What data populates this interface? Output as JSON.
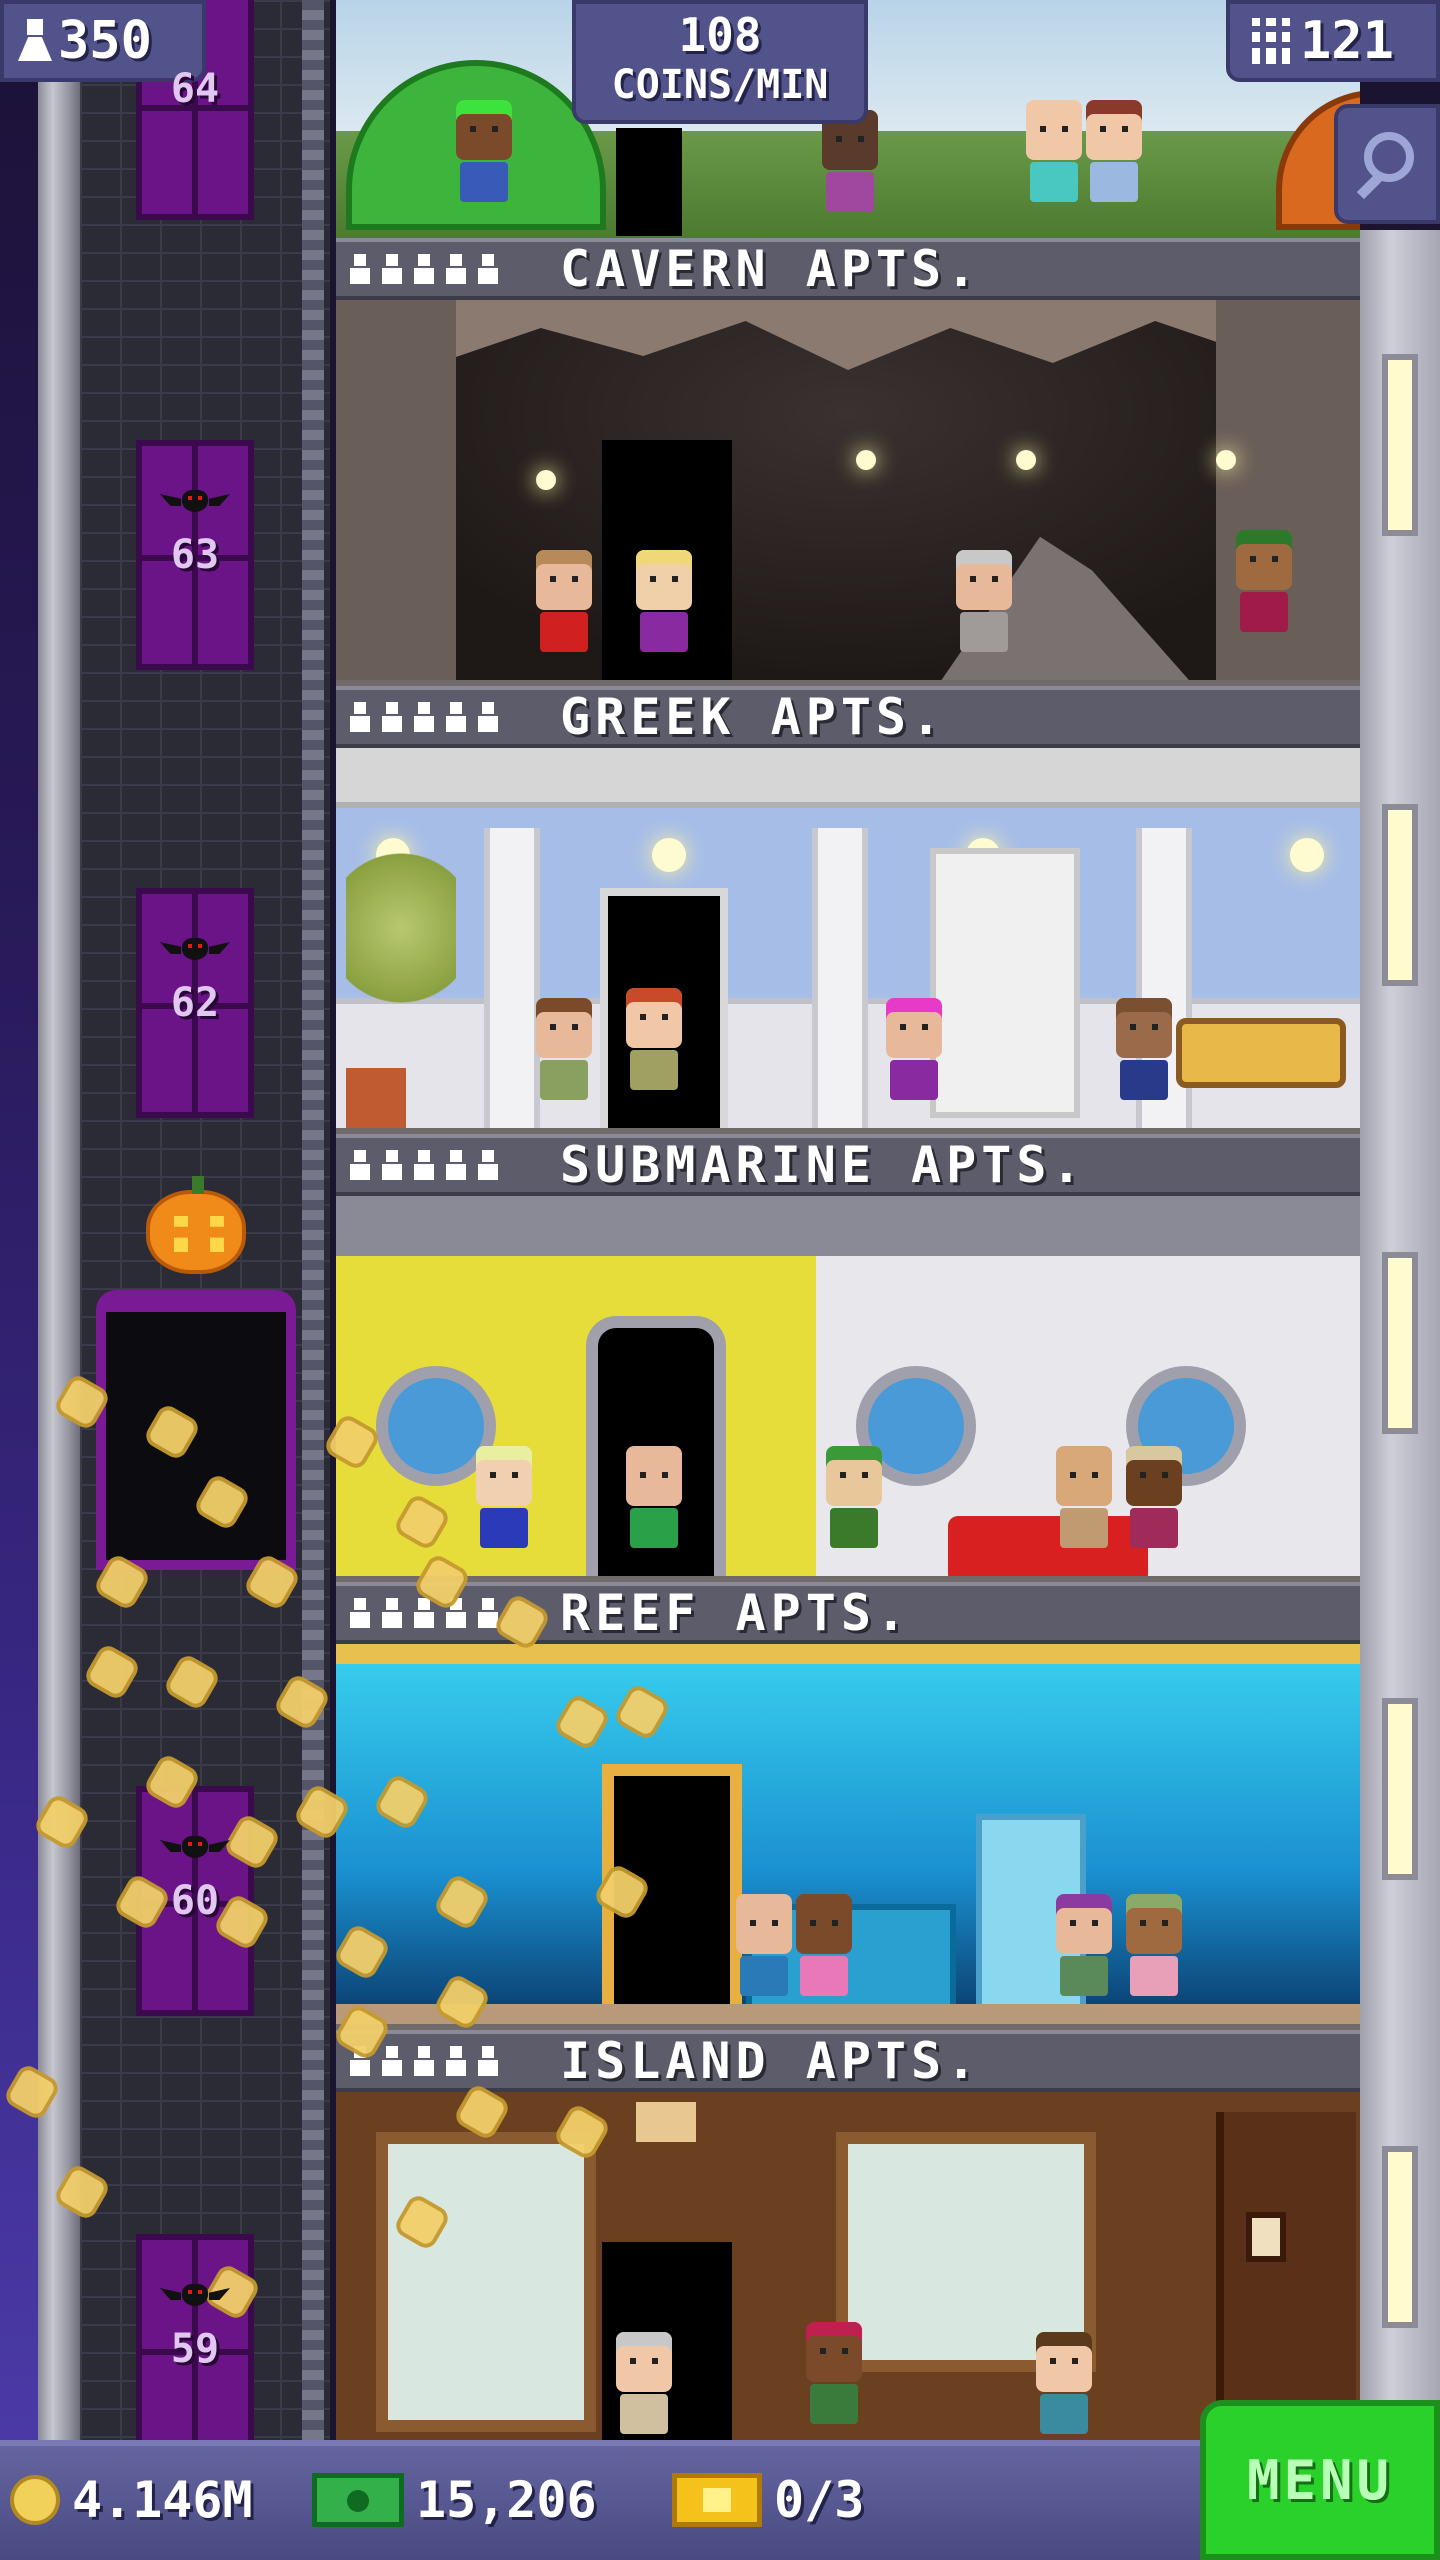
{
  "hud": {
    "population": "350",
    "coins_per_min_value": "108",
    "coins_per_min_unit": "COINS/MIN",
    "floor_count": "121"
  },
  "stairs": [
    {
      "floor": "64"
    },
    {
      "floor": "63"
    },
    {
      "floor": "62"
    },
    {
      "floor": "60"
    },
    {
      "floor": "59"
    }
  ],
  "floors": [
    {
      "name": "CAVERN APTS."
    },
    {
      "name": "GREEK APTS."
    },
    {
      "name": "SUBMARINE APTS."
    },
    {
      "name": "REEF APTS."
    },
    {
      "name": "ISLAND APTS."
    }
  ],
  "bottom_bar": {
    "coins": "4.146M",
    "bux": "15,206",
    "tickets": "0/3",
    "menu_label": "MENU"
  },
  "colors": {
    "hud_panel": "#53538c",
    "menu_green": "#2bd12b",
    "stairwell_purple": "#6a1488",
    "coin_gold": "#f2cf6a"
  },
  "icons": [
    "person-icon",
    "building-icon",
    "magnifier-icon",
    "coin-icon",
    "bux-cash-icon",
    "vip-ticket-icon",
    "bat-icon",
    "pumpkin-icon"
  ]
}
